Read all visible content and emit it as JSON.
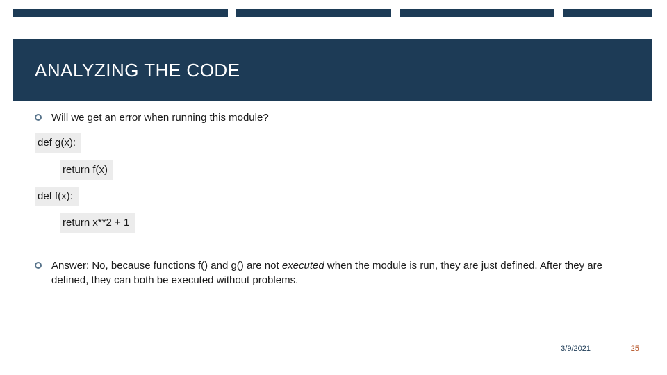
{
  "title": "ANALYZING THE CODE",
  "bullets": {
    "question": "Will we get an error when running this module?",
    "answer_prefix": "Answer: No, because functions f() and g() are not ",
    "answer_emph": "executed",
    "answer_suffix": " when the module is run, they are just defined. After they are defined, they can both be executed without problems."
  },
  "code": {
    "l1": "def g(x):",
    "l2": "return f(x)",
    "l3": "def f(x):",
    "l4": "return x**2 + 1"
  },
  "footer": {
    "date": "3/9/2021",
    "page": "25"
  },
  "tabs": {
    "widths": [
      310,
      12,
      223,
      12,
      223,
      12,
      128
    ]
  }
}
